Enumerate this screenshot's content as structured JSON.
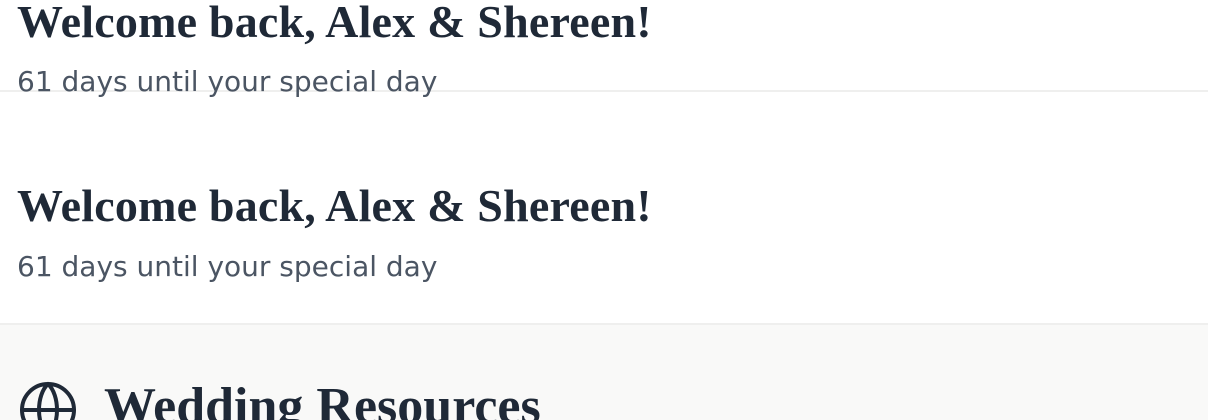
{
  "welcome_cards": [
    {
      "title": "Welcome back, Alex & Shereen!",
      "subtitle": "61 days until your special day"
    },
    {
      "title": "Welcome back, Alex & Shereen!",
      "subtitle": "61 days until your special day"
    }
  ],
  "resources": {
    "title": "Wedding Resources",
    "icon": "globe-icon"
  },
  "colors": {
    "heading": "#1f2937",
    "subtext": "#4b5563",
    "divider": "#efefee",
    "resources_background": "#f9f9f8"
  }
}
